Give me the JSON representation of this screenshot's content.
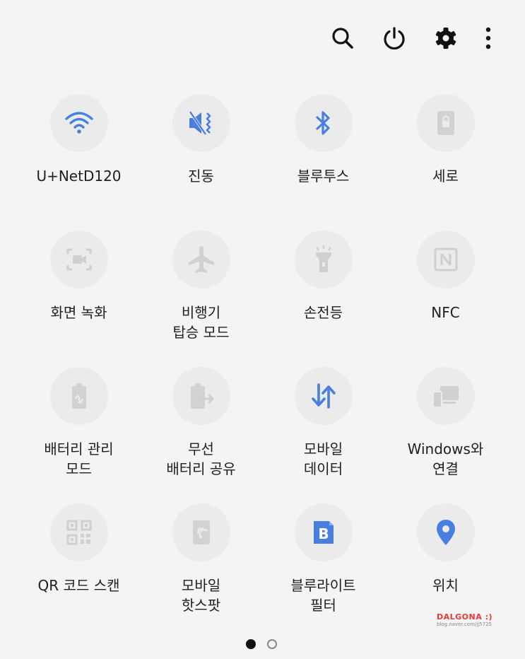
{
  "toolbar": {
    "icons": [
      "search-icon",
      "power-icon",
      "settings-gear-icon",
      "more-vertical-icon"
    ]
  },
  "colors": {
    "active_icon": "#4a7fe0",
    "inactive_icon": "#c9c9c9",
    "tile_background": "#ebebeb",
    "page_background": "#f4f4f4"
  },
  "tiles": [
    {
      "label": "U+NetD120",
      "icon": "wifi-icon",
      "active": true
    },
    {
      "label": "진동",
      "icon": "vibrate-icon",
      "active": true
    },
    {
      "label": "블루투스",
      "icon": "bluetooth-icon",
      "active": true
    },
    {
      "label": "세로",
      "icon": "portrait-lock-icon",
      "active": false
    },
    {
      "label": "화면 녹화",
      "icon": "screen-record-icon",
      "active": false
    },
    {
      "label": "비행기\n탑승 모드",
      "icon": "airplane-icon",
      "active": false
    },
    {
      "label": "손전등",
      "icon": "flashlight-icon",
      "active": false
    },
    {
      "label": "NFC",
      "icon": "nfc-icon",
      "active": false
    },
    {
      "label": "배터리 관리\n모드",
      "icon": "battery-saver-icon",
      "active": false
    },
    {
      "label": "무선\n배터리 공유",
      "icon": "wireless-powershare-icon",
      "active": false
    },
    {
      "label": "모바일\n데이터",
      "icon": "mobile-data-icon",
      "active": true
    },
    {
      "label": "Windows와\n연결",
      "icon": "link-to-windows-icon",
      "active": false
    },
    {
      "label": "QR 코드 스캔",
      "icon": "qr-code-icon",
      "active": false
    },
    {
      "label": "모바일\n핫스팟",
      "icon": "hotspot-icon",
      "active": false
    },
    {
      "label": "블루라이트\n필터",
      "icon": "blue-light-filter-icon",
      "active": true
    },
    {
      "label": "위치",
      "icon": "location-pin-icon",
      "active": true
    }
  ],
  "pagination": {
    "current": 1,
    "total": 2
  },
  "watermark": {
    "title": "DALGONA :)",
    "url": "blog.naver.com/jj5725"
  }
}
